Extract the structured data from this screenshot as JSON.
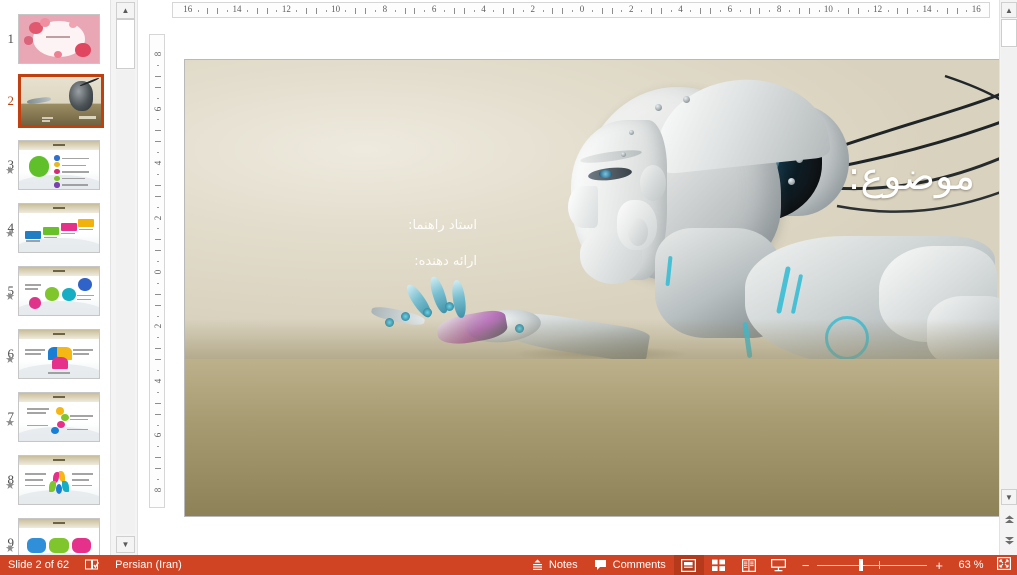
{
  "app": {
    "name": "PowerPoint Normal View"
  },
  "thumbnails": {
    "panel_name": "slide-thumbnail-panel",
    "animation_marker": "★",
    "slides": [
      {
        "number": "1",
        "animated": false,
        "selected": false,
        "kind": "pink-floral-cover"
      },
      {
        "number": "2",
        "animated": false,
        "selected": true,
        "kind": "robot-title"
      },
      {
        "number": "3",
        "animated": true,
        "selected": false,
        "kind": "green-circle-list"
      },
      {
        "number": "4",
        "animated": true,
        "selected": false,
        "kind": "colored-banners"
      },
      {
        "number": "5",
        "animated": true,
        "selected": false,
        "kind": "colored-spheres"
      },
      {
        "number": "6",
        "animated": true,
        "selected": false,
        "kind": "tri-arrow-loop"
      },
      {
        "number": "7",
        "animated": true,
        "selected": false,
        "kind": "dot-cluster"
      },
      {
        "number": "8",
        "animated": true,
        "selected": false,
        "kind": "flower-petals"
      },
      {
        "number": "9",
        "animated": true,
        "selected": false,
        "kind": "speech-bubbles"
      }
    ]
  },
  "rulers": {
    "horizontal_labels": [
      "16",
      "14",
      "12",
      "10",
      "8",
      "6",
      "4",
      "2",
      "0",
      "2",
      "4",
      "6",
      "8",
      "10",
      "12",
      "14",
      "16"
    ],
    "vertical_labels": [
      "8",
      "6",
      "4",
      "2",
      "0",
      "2",
      "4",
      "6",
      "8"
    ]
  },
  "slide": {
    "title": "موضوع:",
    "line1": "استاد راهنما:",
    "line2": "ارائه دهنده:",
    "image_alt": "humanoid robot head in profile reaching with robotic hand",
    "band_color_top": "#bcb18b",
    "band_color_bottom": "#8d8257"
  },
  "status_bar": {
    "slide_counter": "Slide 2 of 62",
    "proofing_icon": "spell-check-icon",
    "language": "Persian (Iran)",
    "notes_label": "Notes",
    "notes_icon": "notes-icon",
    "comments_label": "Comments",
    "comments_icon": "comments-icon",
    "views": [
      {
        "name": "normal-view",
        "icon": "normal-view-icon",
        "active": true
      },
      {
        "name": "slide-sorter-view",
        "icon": "slide-sorter-icon",
        "active": false
      },
      {
        "name": "reading-view",
        "icon": "reading-view-icon",
        "active": false
      },
      {
        "name": "slide-show-view",
        "icon": "slide-show-icon",
        "active": false
      }
    ],
    "zoom_out_label": "−",
    "zoom_in_label": "+",
    "zoom_level": "63 %",
    "fit_label": "⛶",
    "accent_color": "#d04423"
  },
  "scrollbars": {
    "up_arrow": "▲",
    "down_arrow": "▼",
    "prev_slide": "▲",
    "next_slide": "▼"
  }
}
